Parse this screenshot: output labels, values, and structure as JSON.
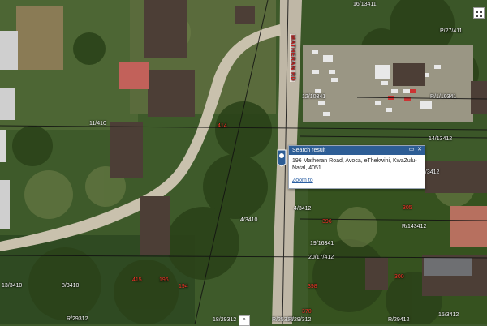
{
  "map": {
    "road_name": "MATHERAN RD",
    "parcel_labels": [
      "16/13411",
      "P/27/411",
      "12/10341",
      "R/1/10341",
      "11/410",
      "14/13412",
      "4/3412",
      "2/3412",
      "R/143412",
      "19/16341",
      "20/17/412",
      "4/3410",
      "8/3410",
      "13/3410",
      "R/29312",
      "18/29312",
      "R/25312",
      "R/29/312",
      "R/29412",
      "15/3412"
    ],
    "red_labels": [
      "414",
      "415",
      "196",
      "194",
      "396",
      "398",
      "300",
      "370",
      "305"
    ]
  },
  "popup": {
    "title": "Search result",
    "address": "196 Matheran Road, Avoca, eThekwini, KwaZulu-Natal, 4051",
    "zoom_link": "Zoom to",
    "minimize_icon": "▭",
    "close_icon": "✕"
  },
  "controls": {
    "grid_icon": "grid-icon",
    "collapse_icon": "^"
  }
}
